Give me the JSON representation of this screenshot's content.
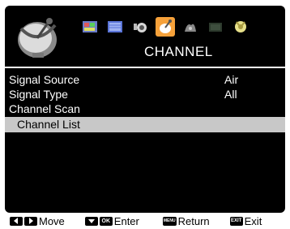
{
  "header": {
    "title": "CHANNEL",
    "tabs": [
      {
        "icon": "picture-icon",
        "active": false
      },
      {
        "icon": "screen-icon",
        "active": false
      },
      {
        "icon": "sound-icon",
        "active": false
      },
      {
        "icon": "channel-antenna-icon",
        "active": true
      },
      {
        "icon": "lock-icon",
        "active": false
      },
      {
        "icon": "time-icon",
        "active": false
      },
      {
        "icon": "setup-icon",
        "active": false
      }
    ]
  },
  "menu": {
    "items": [
      {
        "label": "Signal Source",
        "value": "Air"
      },
      {
        "label": "Signal Type",
        "value": "All"
      },
      {
        "label": "Channel Scan",
        "value": ""
      },
      {
        "label": "Channel List",
        "value": "",
        "selected": true
      }
    ]
  },
  "footer": {
    "move": "Move",
    "enter": "Enter",
    "return": "Return",
    "exit": "Exit",
    "ok_key": "OK",
    "menu_key": "MENU",
    "exit_key": "EXIT"
  },
  "colors": {
    "background": "#000000",
    "accent": "#f6a13a",
    "selected_row": "#c8c8c8",
    "text": "#ffffff"
  }
}
